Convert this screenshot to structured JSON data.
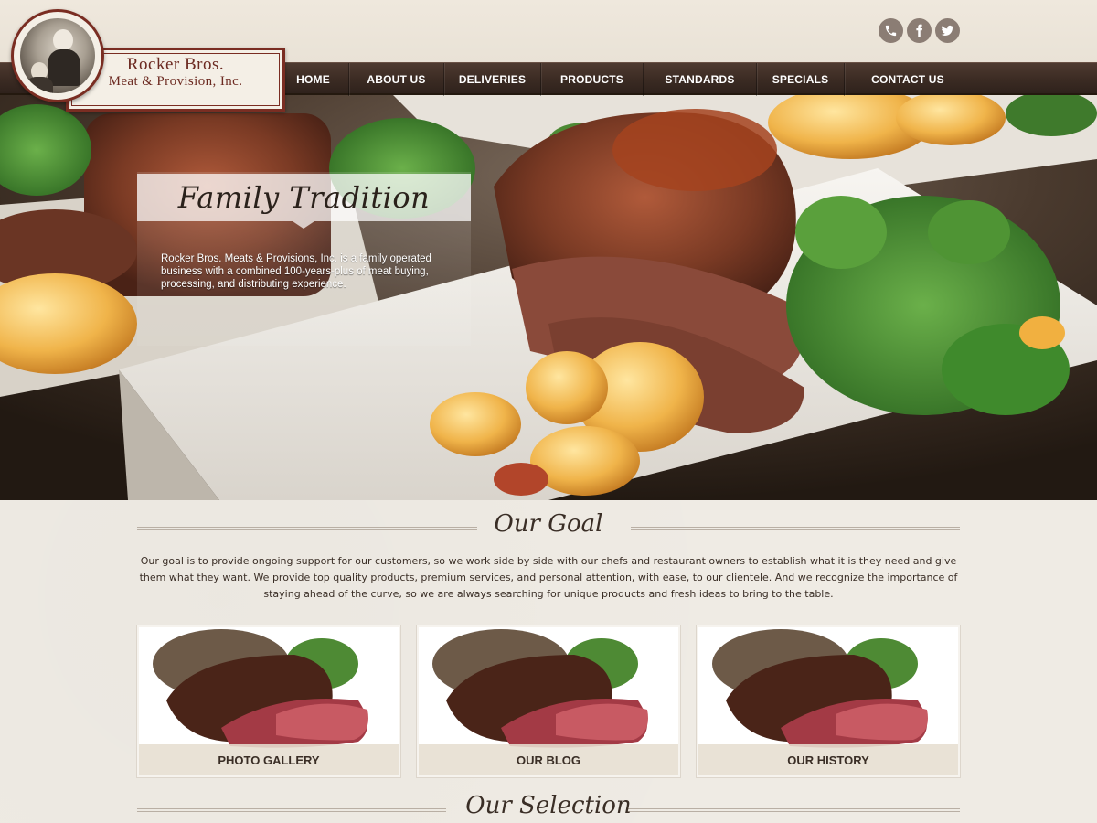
{
  "brand": {
    "line1": "Rocker Bros.",
    "line2": "Meat & Provision, Inc."
  },
  "social": [
    {
      "icon": "phone-icon"
    },
    {
      "icon": "facebook-icon"
    },
    {
      "icon": "twitter-icon"
    }
  ],
  "nav": {
    "items": [
      {
        "label": "HOME"
      },
      {
        "label": "ABOUT US"
      },
      {
        "label": "DELIVERIES"
      },
      {
        "label": "PRODUCTS"
      },
      {
        "label": "STANDARDS"
      },
      {
        "label": "SPECIALS"
      },
      {
        "label": "CONTACT US"
      }
    ]
  },
  "hero": {
    "title": "Family Tradition",
    "text": "Rocker Bros. Meats & Provisions, Inc. is a family operated business with a combined 100-years-plus of meat buying, processing, and distributing experience."
  },
  "goal": {
    "heading": "Our Goal",
    "text": "Our goal is to provide ongoing support for our customers, so we work side by side with our chefs and restaurant owners to establish what it is they need and give them what they want. We provide top quality products, premium services, and personal attention, with ease, to our clientele.  And we recognize the importance of staying ahead of the curve, so we are always searching for unique products and fresh ideas to bring to the table."
  },
  "cards": [
    {
      "label": "PHOTO GALLERY"
    },
    {
      "label": "OUR BLOG"
    },
    {
      "label": "OUR HISTORY"
    }
  ],
  "selection": {
    "heading": "Our Selection"
  },
  "colors": {
    "nav_bg": "#3b2b23",
    "brand_red": "#7a2d22",
    "page_bg": "#efebe4",
    "social_bg": "#8b7d74"
  }
}
